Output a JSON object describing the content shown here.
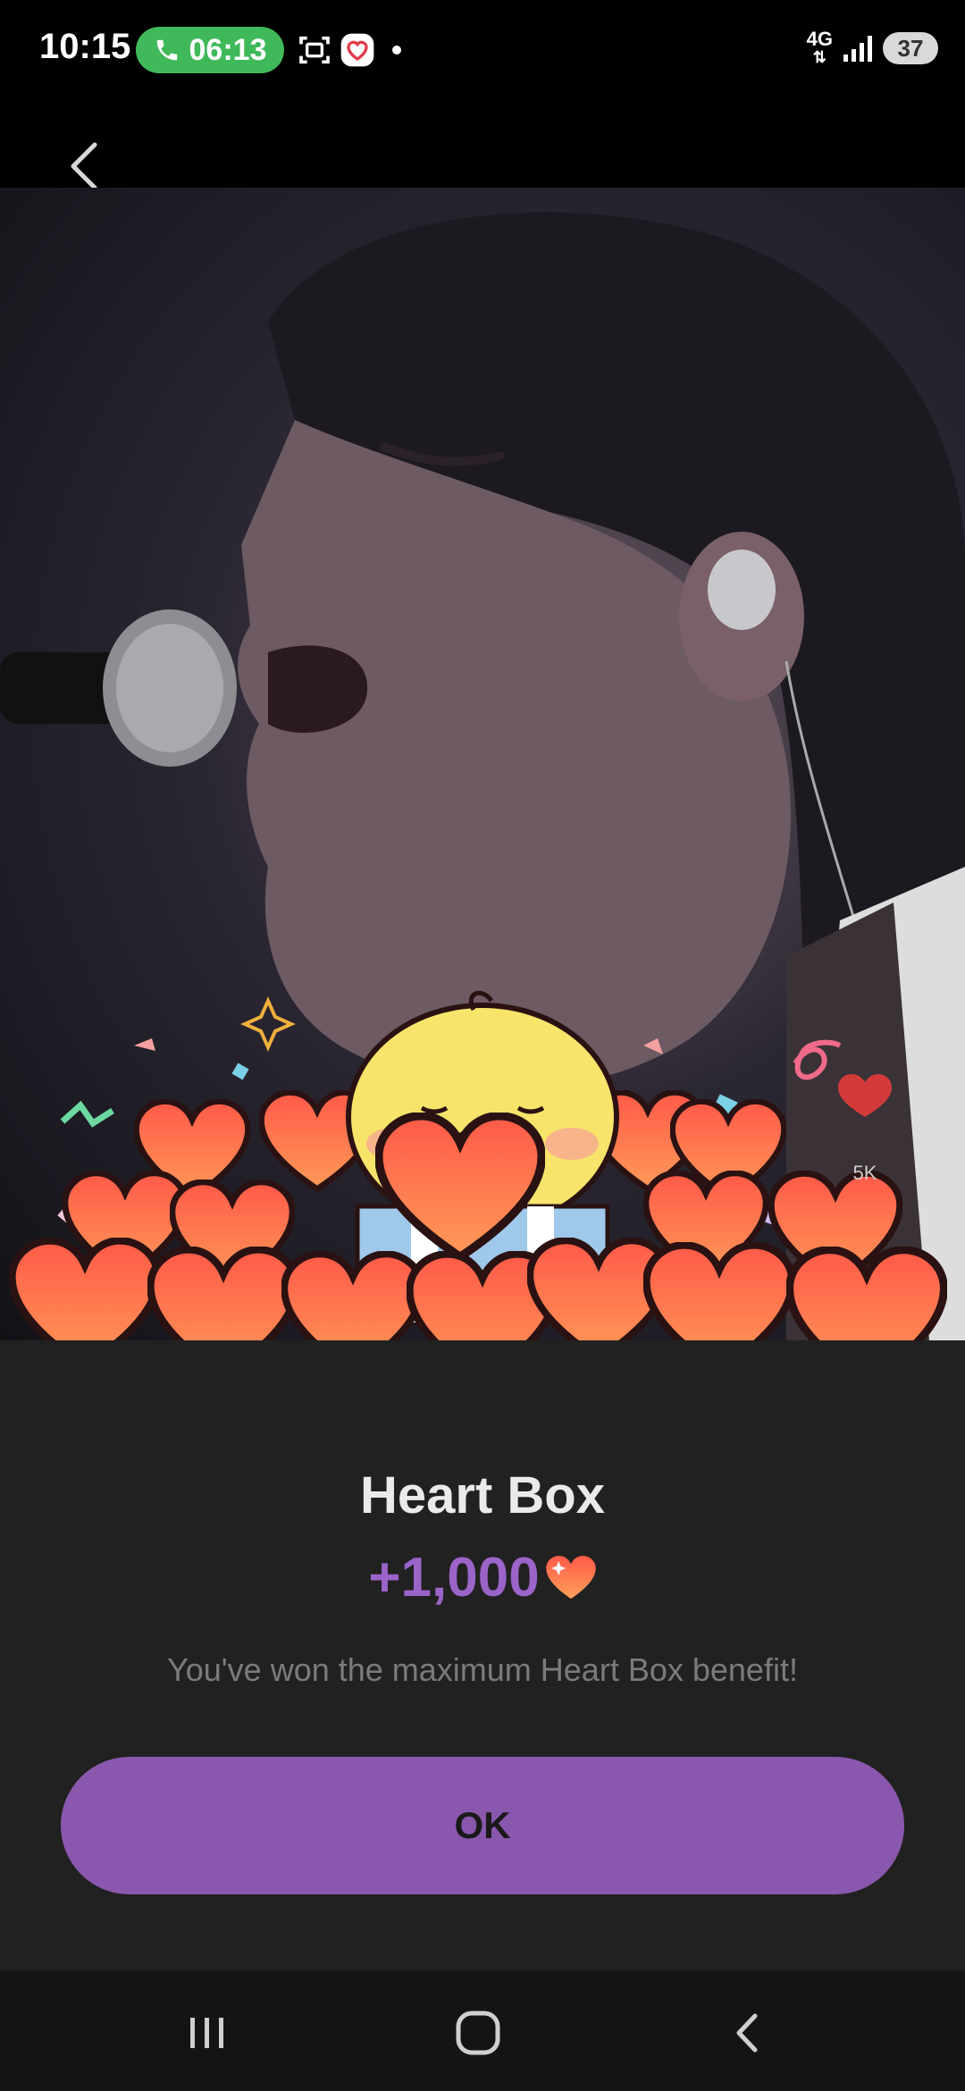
{
  "status_bar": {
    "time": "10:15",
    "call_timer": "06:13",
    "network": "4G",
    "battery": "37"
  },
  "dialog": {
    "title": "Heart Box",
    "amount": "+1,000",
    "message": "You've won the maximum Heart Box benefit!",
    "ok_label": "OK"
  },
  "video": {
    "like_count": "5K"
  },
  "colors": {
    "accent": "#8a57ae",
    "amount": "#9b64c9",
    "heart": "#f0604a",
    "call_pill": "#3fb95a"
  }
}
